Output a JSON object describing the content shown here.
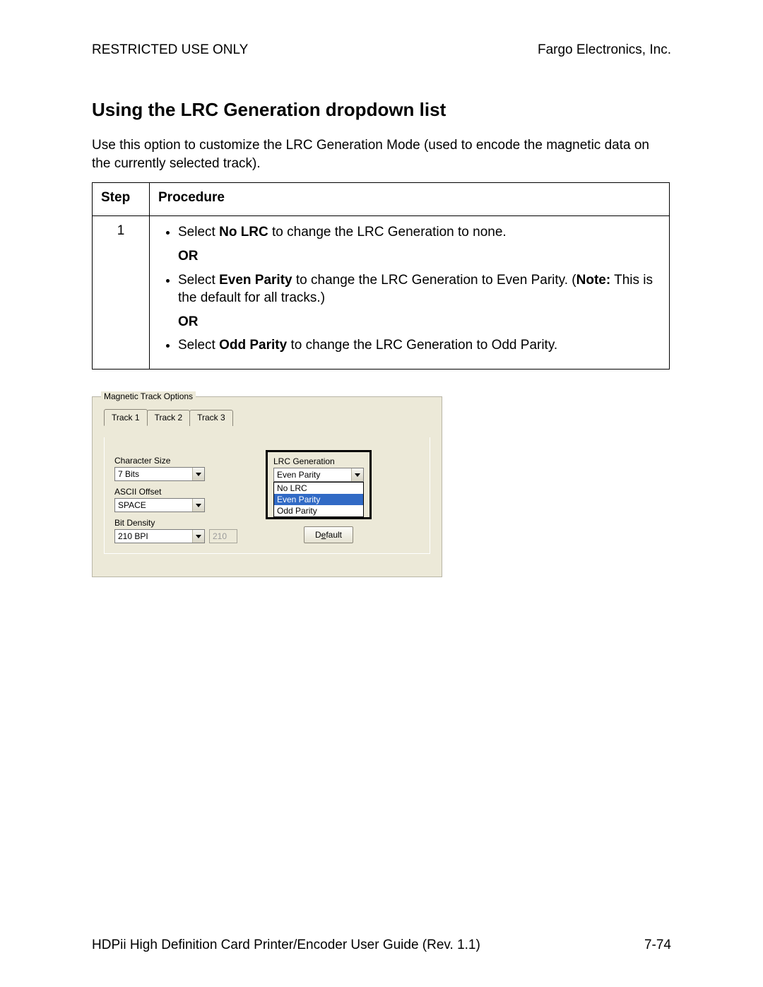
{
  "header": {
    "left": "RESTRICTED USE ONLY",
    "right": "Fargo Electronics, Inc."
  },
  "title": "Using the LRC Generation dropdown list",
  "intro": "Use this option to customize the LRC Generation Mode (used to encode the magnetic data on the currently selected track).",
  "table": {
    "col_step": "Step",
    "col_proc": "Procedure",
    "step_num": "1",
    "b1_pre": "Select ",
    "b1_bold": "No LRC",
    "b1_post": " to change the LRC Generation to none.",
    "or": "OR",
    "b2_pre": "Select ",
    "b2_bold": "Even Parity",
    "b2_mid": " to change the LRC Generation to Even Parity. (",
    "b2_note": "Note:",
    "b2_post": " This is the default for all tracks.)",
    "b3_pre": "Select ",
    "b3_bold": "Odd Parity",
    "b3_post": " to change the LRC Generation to Odd Parity."
  },
  "dialog": {
    "group_label": "Magnetic Track Options",
    "tabs": [
      "Track 1",
      "Track 2",
      "Track 3"
    ],
    "char_size_label": "Character Size",
    "char_size_value": "7 Bits",
    "ascii_label": "ASCII Offset",
    "ascii_value": "SPACE",
    "bit_label": "Bit Density",
    "bit_value": "210 BPI",
    "bit_text": "210",
    "lrc_label": "LRC Generation",
    "lrc_value": "Even Parity",
    "lrc_options": [
      "No LRC",
      "Even Parity",
      "Odd Parity"
    ],
    "default_btn_pre": "D",
    "default_btn_ul": "e",
    "default_btn_post": "fault"
  },
  "footer": {
    "left": "HDPii High Definition Card Printer/Encoder User Guide (Rev. 1.1)",
    "right": "7-74"
  }
}
